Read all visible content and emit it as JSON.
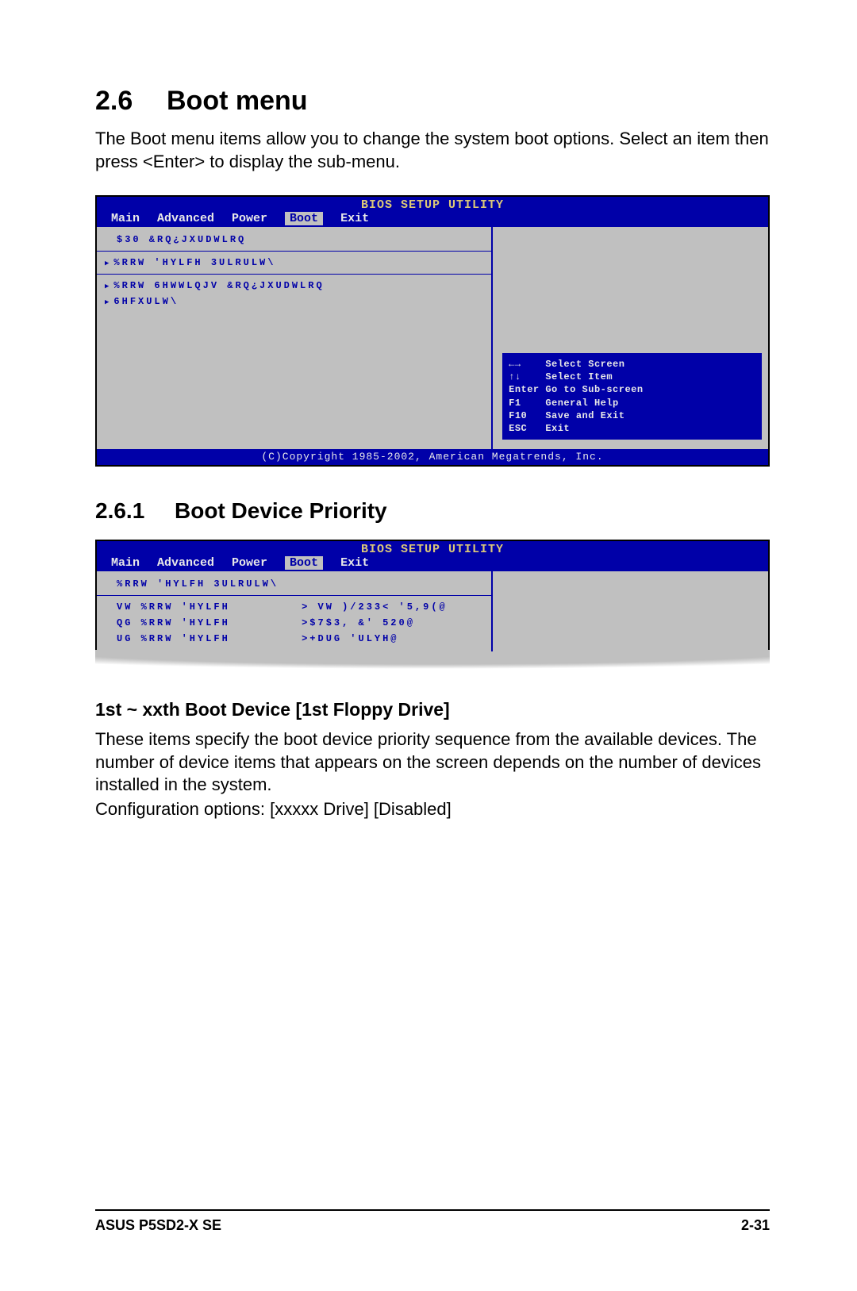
{
  "section": {
    "number": "2.6",
    "title": "Boot menu",
    "intro": "The Boot menu items allow you to change the system boot options. Select an item then press <Enter> to display the sub-menu."
  },
  "bios1": {
    "title": "BIOS SETUP UTILITY",
    "tabs": {
      "main": "Main",
      "advanced": "Advanced",
      "power": "Power",
      "boot": "Boot",
      "exit": "Exit"
    },
    "items": {
      "apm": "$30 &RQ¿JXUDWLRQ",
      "bootDevicePriority": "%RRW 'HYLFH 3ULRULW\\",
      "bootSettings": "%RRW 6HWWLQJV &RQ¿JXUDWLRQ",
      "security": "6HFXULW\\"
    },
    "help": {
      "l1": "←→    Select Screen",
      "l2": "↑↓    Select Item",
      "l3": "Enter Go to Sub-screen",
      "l4": "F1    General Help",
      "l5": "F10   Save and Exit",
      "l6": "ESC   Exit"
    },
    "copyright": "(C)Copyright 1985-2002, American Megatrends, Inc."
  },
  "subsection": {
    "number": "2.6.1",
    "title": "Boot Device Priority"
  },
  "bios2": {
    "title": "BIOS SETUP UTILITY",
    "tabs": {
      "main": "Main",
      "advanced": "Advanced",
      "power": "Power",
      "boot": "Boot",
      "exit": "Exit"
    },
    "header": "%RRW 'HYLFH 3ULRULW\\",
    "rows": {
      "r1a": "VW %RRW 'HYLFH",
      "r1b": "> VW )/233< '5,9(@",
      "r2a": "QG %RRW 'HYLFH",
      "r2b": ">$7$3, &' 520@",
      "r3a": "UG %RRW 'HYLFH",
      "r3b": ">+DUG 'ULYH@"
    }
  },
  "subhead": "1st ~ xxth Boot Device [1st Floppy Drive]",
  "para1": "These items specify the boot device priority sequence from the available devices. The number of device items that appears on the screen depends on the number of devices installed in the system.",
  "para2": "Configuration options: [xxxxx Drive] [Disabled]",
  "footer": {
    "left": "ASUS P5SD2-X SE",
    "right": "2-31"
  }
}
